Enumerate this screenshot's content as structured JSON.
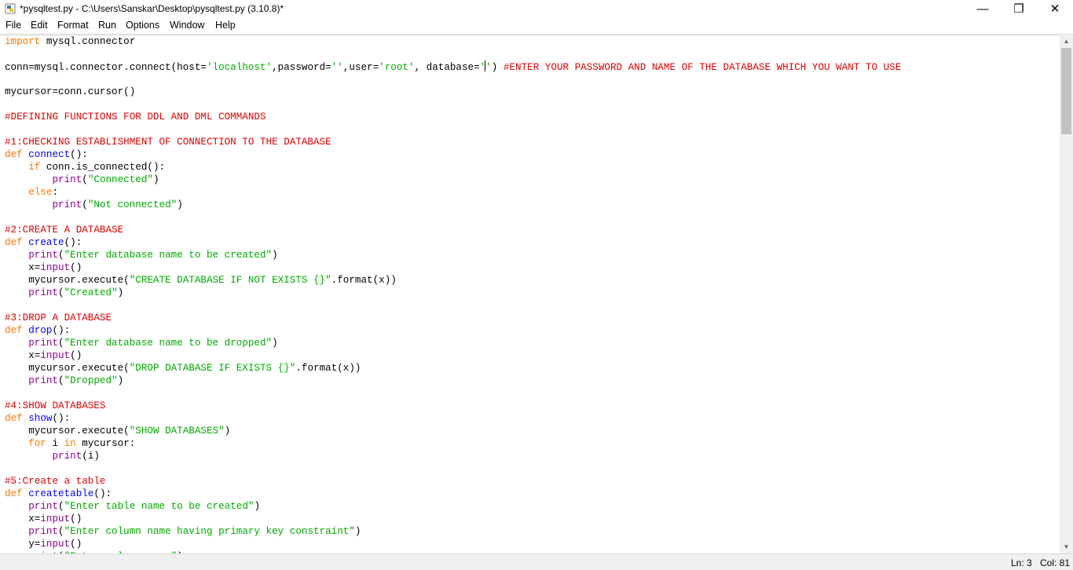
{
  "window": {
    "title": "*pysqltest.py - C:\\Users\\Sanskar\\Desktop\\pysqltest.py (3.10.8)*",
    "minimize_glyph": "—",
    "maximize_glyph": "❐",
    "close_glyph": "✕"
  },
  "menu": [
    "File",
    "Edit",
    "Format",
    "Run",
    "Options",
    "Window",
    "Help"
  ],
  "status": {
    "ln": "Ln: 3",
    "col": "Col: 81"
  },
  "colors": {
    "keyword": "#ff7700",
    "builtin": "#900090",
    "string": "#00aa00",
    "comment": "#dd0000",
    "definition": "#0000ff"
  },
  "icons": [
    "python-idle-icon",
    "minimize-icon",
    "maximize-icon",
    "close-icon",
    "scroll-up-icon",
    "scroll-down-icon"
  ],
  "code": [
    [
      [
        "kw",
        "import"
      ],
      [
        "n",
        " mysql.connector"
      ]
    ],
    [],
    [
      [
        "n",
        "conn=mysql.connector.connect(host="
      ],
      [
        "str",
        "'localhost'"
      ],
      [
        "n",
        ",password="
      ],
      [
        "str",
        "''"
      ],
      [
        "n",
        ",user="
      ],
      [
        "str",
        "'root'"
      ],
      [
        "n",
        ", database="
      ],
      [
        "str",
        "'"
      ],
      [
        "cursor",
        ""
      ],
      [
        "str",
        "'"
      ],
      [
        "n",
        ") "
      ],
      [
        "cm",
        "#ENTER YOUR PASSWORD AND NAME OF THE DATABASE WHICH YOU WANT TO USE"
      ]
    ],
    [],
    [
      [
        "n",
        "mycursor=conn.cursor()"
      ]
    ],
    [],
    [
      [
        "cm",
        "#DEFINING FUNCTIONS FOR DDL AND DML COMMANDS"
      ]
    ],
    [],
    [
      [
        "cm",
        "#1:CHECKING ESTABLISHMENT OF CONNECTION TO THE DATABASE"
      ]
    ],
    [
      [
        "kw",
        "def"
      ],
      [
        "n",
        " "
      ],
      [
        "fn",
        "connect"
      ],
      [
        "n",
        "():"
      ]
    ],
    [
      [
        "n",
        "    "
      ],
      [
        "kw",
        "if"
      ],
      [
        "n",
        " conn.is_connected():"
      ]
    ],
    [
      [
        "n",
        "        "
      ],
      [
        "bi",
        "print"
      ],
      [
        "n",
        "("
      ],
      [
        "str",
        "\"Connected\""
      ],
      [
        "n",
        ")"
      ]
    ],
    [
      [
        "n",
        "    "
      ],
      [
        "kw",
        "else"
      ],
      [
        "n",
        ":"
      ]
    ],
    [
      [
        "n",
        "        "
      ],
      [
        "bi",
        "print"
      ],
      [
        "n",
        "("
      ],
      [
        "str",
        "\"Not connected\""
      ],
      [
        "n",
        ")"
      ]
    ],
    [],
    [
      [
        "cm",
        "#2:CREATE A DATABASE"
      ]
    ],
    [
      [
        "kw",
        "def"
      ],
      [
        "n",
        " "
      ],
      [
        "fn",
        "create"
      ],
      [
        "n",
        "():"
      ]
    ],
    [
      [
        "n",
        "    "
      ],
      [
        "bi",
        "print"
      ],
      [
        "n",
        "("
      ],
      [
        "str",
        "\"Enter database name to be created\""
      ],
      [
        "n",
        ")"
      ]
    ],
    [
      [
        "n",
        "    x="
      ],
      [
        "bi",
        "input"
      ],
      [
        "n",
        "()"
      ]
    ],
    [
      [
        "n",
        "    mycursor.execute("
      ],
      [
        "str",
        "\"CREATE DATABASE IF NOT EXISTS {}\""
      ],
      [
        "n",
        ".format(x))"
      ]
    ],
    [
      [
        "n",
        "    "
      ],
      [
        "bi",
        "print"
      ],
      [
        "n",
        "("
      ],
      [
        "str",
        "\"Created\""
      ],
      [
        "n",
        ")"
      ]
    ],
    [],
    [
      [
        "cm",
        "#3:DROP A DATABASE"
      ]
    ],
    [
      [
        "kw",
        "def"
      ],
      [
        "n",
        " "
      ],
      [
        "fn",
        "drop"
      ],
      [
        "n",
        "():"
      ]
    ],
    [
      [
        "n",
        "    "
      ],
      [
        "bi",
        "print"
      ],
      [
        "n",
        "("
      ],
      [
        "str",
        "\"Enter database name to be dropped\""
      ],
      [
        "n",
        ")"
      ]
    ],
    [
      [
        "n",
        "    x="
      ],
      [
        "bi",
        "input"
      ],
      [
        "n",
        "()"
      ]
    ],
    [
      [
        "n",
        "    mycursor.execute("
      ],
      [
        "str",
        "\"DROP DATABASE IF EXISTS {}\""
      ],
      [
        "n",
        ".format(x))"
      ]
    ],
    [
      [
        "n",
        "    "
      ],
      [
        "bi",
        "print"
      ],
      [
        "n",
        "("
      ],
      [
        "str",
        "\"Dropped\""
      ],
      [
        "n",
        ")"
      ]
    ],
    [],
    [
      [
        "cm",
        "#4:SHOW DATABASES"
      ]
    ],
    [
      [
        "kw",
        "def"
      ],
      [
        "n",
        " "
      ],
      [
        "fn",
        "show"
      ],
      [
        "n",
        "():"
      ]
    ],
    [
      [
        "n",
        "    mycursor.execute("
      ],
      [
        "str",
        "\"SHOW DATABASES\""
      ],
      [
        "n",
        ")"
      ]
    ],
    [
      [
        "n",
        "    "
      ],
      [
        "kw",
        "for"
      ],
      [
        "n",
        " i "
      ],
      [
        "kw",
        "in"
      ],
      [
        "n",
        " mycursor:"
      ]
    ],
    [
      [
        "n",
        "        "
      ],
      [
        "bi",
        "print"
      ],
      [
        "n",
        "(i)"
      ]
    ],
    [],
    [
      [
        "cm",
        "#5:Create a table"
      ]
    ],
    [
      [
        "kw",
        "def"
      ],
      [
        "n",
        " "
      ],
      [
        "fn",
        "createtable"
      ],
      [
        "n",
        "():"
      ]
    ],
    [
      [
        "n",
        "    "
      ],
      [
        "bi",
        "print"
      ],
      [
        "n",
        "("
      ],
      [
        "str",
        "\"Enter table name to be created\""
      ],
      [
        "n",
        ")"
      ]
    ],
    [
      [
        "n",
        "    x="
      ],
      [
        "bi",
        "input"
      ],
      [
        "n",
        "()"
      ]
    ],
    [
      [
        "n",
        "    "
      ],
      [
        "bi",
        "print"
      ],
      [
        "n",
        "("
      ],
      [
        "str",
        "\"Enter column name having primary key constraint\""
      ],
      [
        "n",
        ")"
      ]
    ],
    [
      [
        "n",
        "    y="
      ],
      [
        "bi",
        "input"
      ],
      [
        "n",
        "()"
      ]
    ],
    [
      [
        "n",
        "    "
      ],
      [
        "bi",
        "print"
      ],
      [
        "n",
        "("
      ],
      [
        "str",
        "\"Enter column name\""
      ],
      [
        "n",
        ")"
      ]
    ]
  ]
}
